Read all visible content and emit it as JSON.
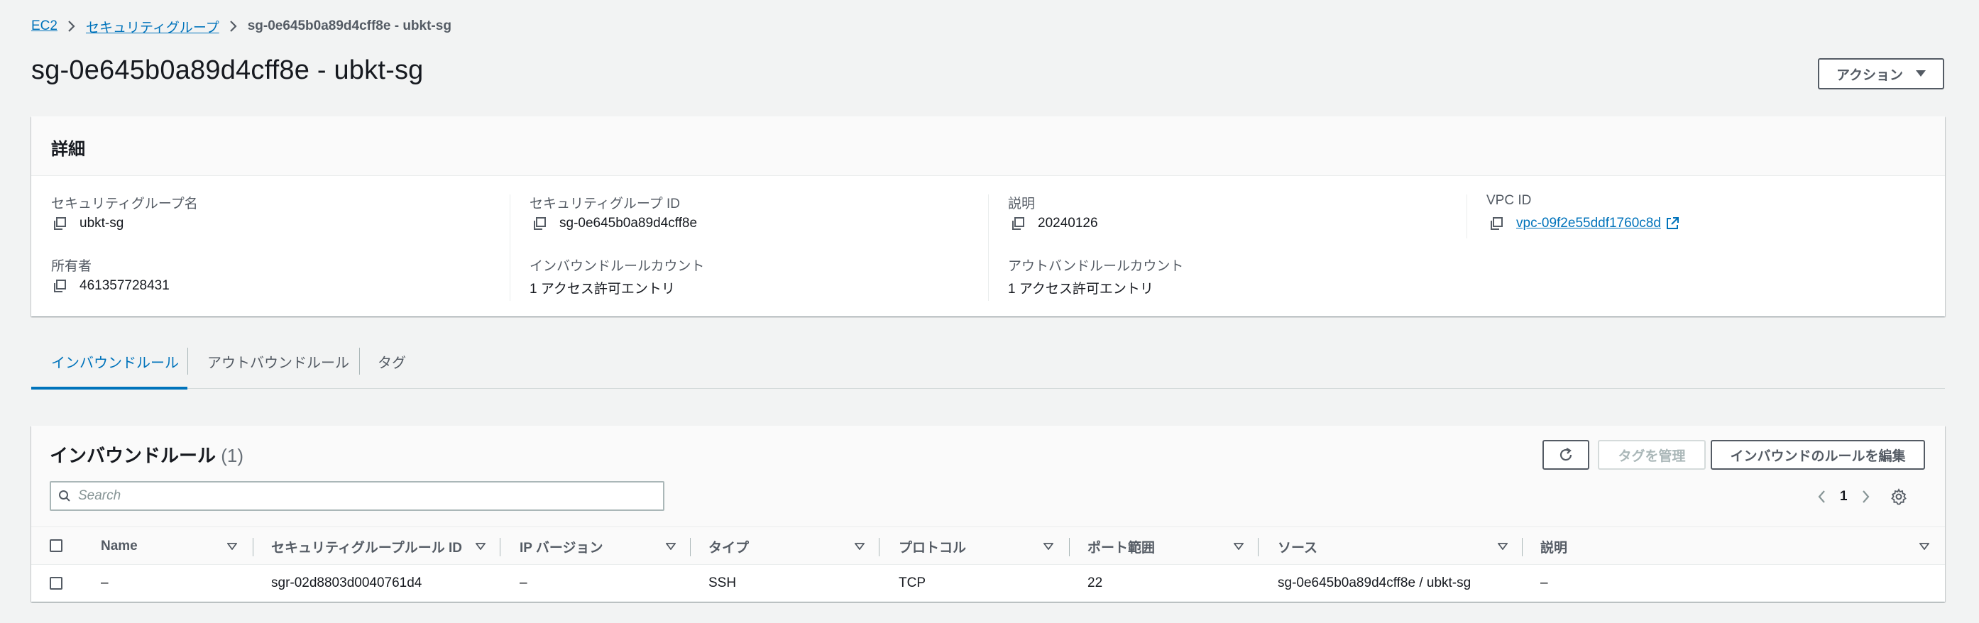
{
  "breadcrumb": {
    "items": [
      "EC2",
      "セキュリティグループ"
    ],
    "current": "sg-0e645b0a89d4cff8e - ubkt-sg"
  },
  "page_title": "sg-0e645b0a89d4cff8e - ubkt-sg",
  "actions_button": "アクション",
  "details": {
    "title": "詳細",
    "fields": [
      {
        "label": "セキュリティグループ名",
        "value": "ubkt-sg"
      },
      {
        "label": "セキュリティグループ ID",
        "value": "sg-0e645b0a89d4cff8e"
      },
      {
        "label": "説明",
        "value": "20240126"
      },
      {
        "label": "VPC ID",
        "value": "vpc-09f2e55ddf1760c8d"
      },
      {
        "label": "所有者",
        "value": "461357728431"
      },
      {
        "label": "インバウンドルールカウント",
        "value": "1 アクセス許可エントリ"
      },
      {
        "label": "アウトバンドルールカウント",
        "value": "1 アクセス許可エントリ"
      }
    ]
  },
  "tabs": [
    {
      "label": "インバウンドルール",
      "active": true
    },
    {
      "label": "アウトバウンドルール",
      "active": false
    },
    {
      "label": "タグ",
      "active": false
    }
  ],
  "inbound": {
    "title": "インバウンドルール",
    "count": "(1)",
    "manage_tags_button": "タグを管理",
    "edit_rules_button": "インバウンドのルールを編集",
    "search_placeholder": "Search",
    "page_number": "1",
    "columns": [
      "Name",
      "セキュリティグループルール ID",
      "IP バージョン",
      "タイプ",
      "プロトコル",
      "ポート範囲",
      "ソース",
      "説明"
    ],
    "rows": [
      [
        "–",
        "sgr-02d8803d0040761d4",
        "–",
        "SSH",
        "TCP",
        "22",
        "sg-0e645b0a89d4cff8e / ubkt-sg",
        "–"
      ]
    ]
  },
  "colors": {
    "link": "#0073bb",
    "text": "#16191f",
    "muted": "#545b64",
    "background": "#f2f3f3"
  },
  "icons": [
    "chevron-right-icon",
    "caret-down-icon",
    "copy-icon",
    "external-link-icon",
    "refresh-icon",
    "search-icon",
    "angle-left-icon",
    "angle-right-icon",
    "settings-icon",
    "sort-caret-icon"
  ]
}
